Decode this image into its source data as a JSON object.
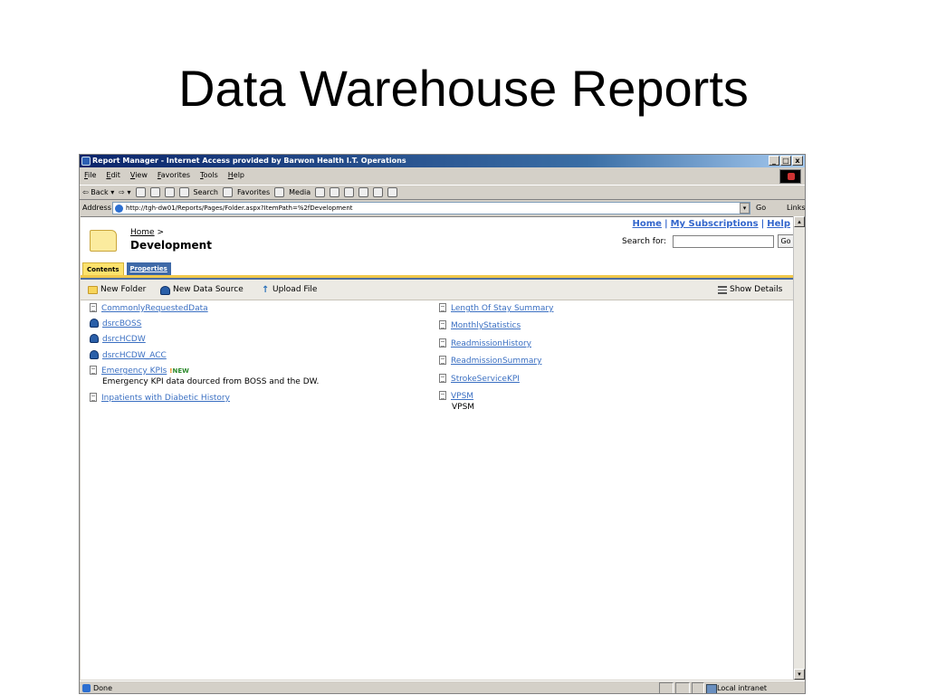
{
  "slide": {
    "title": "Data Warehouse Reports"
  },
  "window": {
    "title": "Report Manager - Internet Access provided by Barwon Health I.T. Operations",
    "buttons": {
      "minimize": "_",
      "restore": "□",
      "close": "x"
    }
  },
  "menubar": {
    "items": [
      "File",
      "Edit",
      "View",
      "Favorites",
      "Tools",
      "Help"
    ]
  },
  "toolbar": {
    "back": "⇦ Back ▾",
    "forward": "⇨ ▾",
    "search": "Search",
    "favorites": "Favorites",
    "media": "Media"
  },
  "addressbar": {
    "label": "Address",
    "url": "http://tgh-dw01/Reports/Pages/Folder.aspx?ItemPath=%2fDevelopment",
    "go_label": "Go",
    "links_label": "Links"
  },
  "page": {
    "breadcrumb": {
      "home": "Home",
      "sep": " >"
    },
    "title": "Development",
    "top_links": {
      "home": "Home",
      "subscriptions": "My Subscriptions",
      "help": "Help",
      "sep": "|"
    },
    "search": {
      "label": "Search for:",
      "go": "Go"
    },
    "tabs": {
      "contents": "Contents",
      "properties": "Properties"
    },
    "actions": {
      "new_folder": "New Folder",
      "new_data_source": "New Data Source",
      "upload_file": "Upload File",
      "show_details": "Show Details"
    },
    "left_items": [
      {
        "label": "CommonlyRequestedData",
        "kind": "report"
      },
      {
        "label": "dsrcBOSS",
        "kind": "datasource"
      },
      {
        "label": "dsrcHCDW",
        "kind": "datasource"
      },
      {
        "label": "dsrcHCDW_ACC",
        "kind": "datasource"
      },
      {
        "label": "Emergency KPIs",
        "kind": "report",
        "badge_mark": "!",
        "badge": "NEW",
        "description": "Emergency KPI data dourced from BOSS and the DW."
      },
      {
        "label": "Inpatients with Diabetic History",
        "kind": "report"
      }
    ],
    "right_items": [
      {
        "label": "Length Of Stay Summary",
        "kind": "report"
      },
      {
        "label": "MonthlyStatistics",
        "kind": "report"
      },
      {
        "label": "ReadmissionHistory",
        "kind": "report"
      },
      {
        "label": "ReadmissionSummary",
        "kind": "report"
      },
      {
        "label": "StrokeServiceKPI",
        "kind": "report"
      },
      {
        "label": "VPSM",
        "kind": "report",
        "description": "VPSM"
      }
    ]
  },
  "statusbar": {
    "text": "Done",
    "zone": "Local intranet"
  }
}
